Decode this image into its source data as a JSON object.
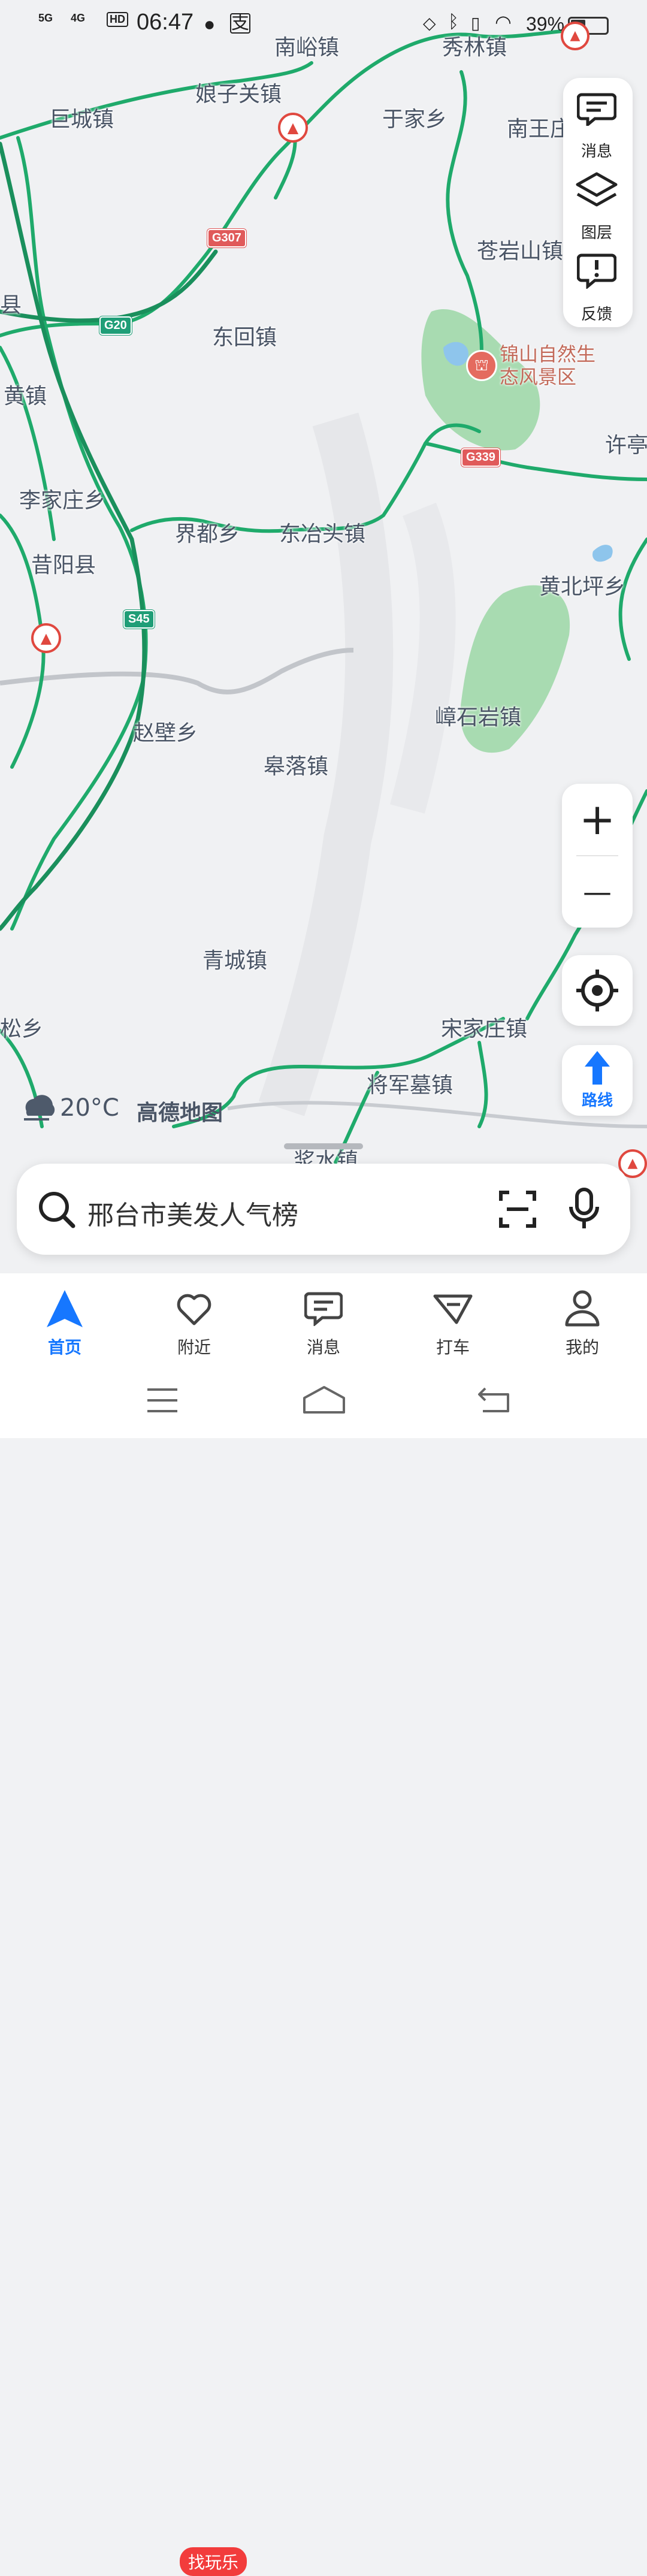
{
  "status_bar": {
    "network_left": "5G",
    "network_right": "4G",
    "hd_label": "HD",
    "time": "06:47",
    "battery_percent": "39%",
    "battery_level": 0.39
  },
  "map": {
    "places": [
      {
        "name": "南峪镇"
      },
      {
        "name": "秀林镇"
      },
      {
        "name": "娘子关镇"
      },
      {
        "name": "巨城镇"
      },
      {
        "name": "于家乡"
      },
      {
        "name": "南王庄"
      },
      {
        "name": "苍岩山镇"
      },
      {
        "name": "东回镇"
      },
      {
        "name": "黄镇"
      },
      {
        "name": "许亭"
      },
      {
        "name": "李家庄乡"
      },
      {
        "name": "界都乡"
      },
      {
        "name": "东冶头镇"
      },
      {
        "name": "昔阳县"
      },
      {
        "name": "黄北坪乡"
      },
      {
        "name": "嶂石岩镇"
      },
      {
        "name": "赵壁乡"
      },
      {
        "name": "皋落镇"
      },
      {
        "name": "青城镇"
      },
      {
        "name": "松乡"
      },
      {
        "name": "宋家庄镇"
      },
      {
        "name": "将军墓镇"
      },
      {
        "name": "浆水镇"
      },
      {
        "name": "县"
      }
    ],
    "scenic": {
      "name": "锦山自然生态风景区"
    },
    "road_shields": [
      "G307",
      "G20",
      "G339",
      "S45"
    ],
    "weather": {
      "temperature": "20°C"
    },
    "attribution": "高德地图"
  },
  "side_panel": {
    "messages_label": "消息",
    "layers_label": "图层",
    "feedback_label": "反馈"
  },
  "zoom": {
    "in_symbol": "+",
    "out_symbol": "—"
  },
  "route_button": {
    "label": "路线"
  },
  "search": {
    "placeholder": "邢台市美发人气榜"
  },
  "tabs": [
    {
      "label": "首页"
    },
    {
      "label": "附近"
    },
    {
      "label": "消息"
    },
    {
      "label": "打车"
    },
    {
      "label": "我的"
    }
  ],
  "nearby_badge": "找玩乐",
  "colors": {
    "accent": "#1677ff",
    "road_green": "#1faa6b",
    "forest": "#8fd3a0",
    "badge_red": "#f23c3c",
    "shield_red": "#e05a5a"
  }
}
